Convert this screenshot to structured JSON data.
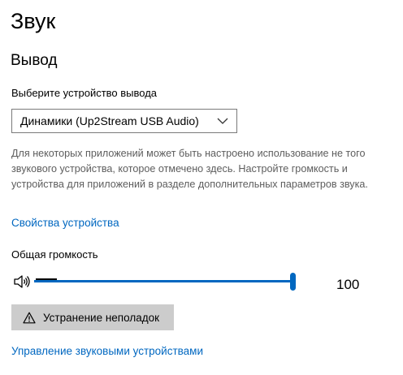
{
  "page": {
    "title": "Звук"
  },
  "output": {
    "section_title": "Вывод",
    "device_label": "Выберите устройство вывода",
    "device_selected": "Динамики (Up2Stream USB Audio)",
    "description": "Для некоторых приложений может быть настроено использование не того звукового устройства, которое отмечено здесь. Настройте громкость и устройства для приложений в разделе дополнительных параметров звука.",
    "device_properties_link": "Свойства устройства",
    "volume_label": "Общая громкость",
    "volume_value": "100",
    "volume_level": 100,
    "speaker_icon": "speaker-volume-icon",
    "troubleshoot_label": "Устранение неполадок",
    "troubleshoot_icon": "warning-icon",
    "manage_devices_link": "Управление звуковыми устройствами"
  },
  "colors": {
    "accent": "#0067c0",
    "description_text": "#5d5d5d",
    "button_bg": "#cccccc",
    "track": "#c8c8c8"
  }
}
